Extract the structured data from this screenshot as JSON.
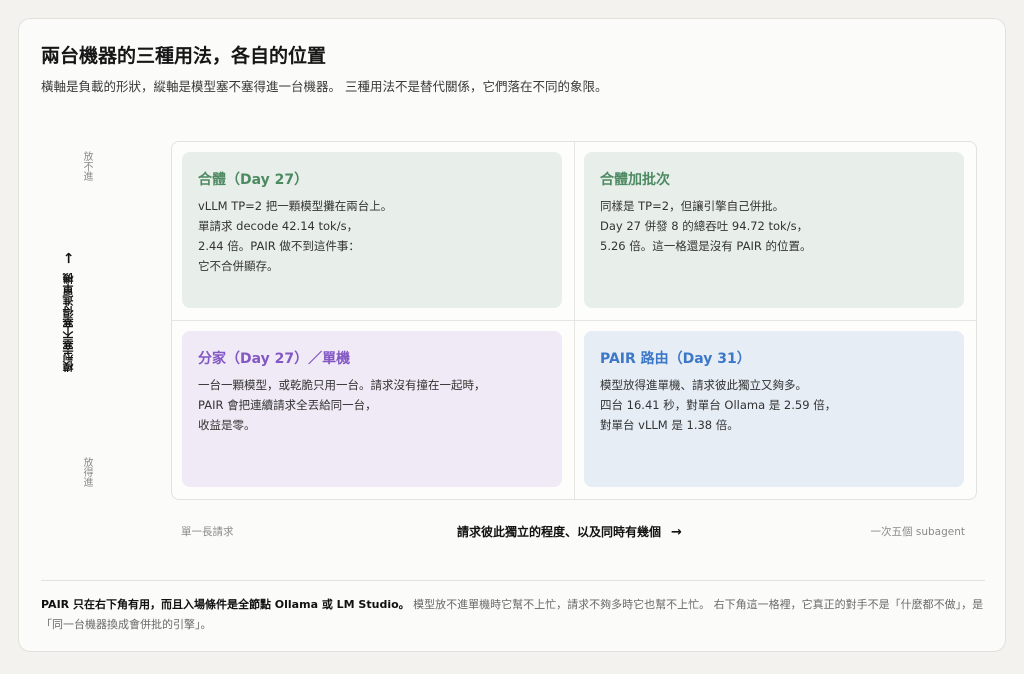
{
  "header": {
    "title": "兩台機器的三種用法，各自的位置",
    "subtitle": "橫軸是負載的形狀，縱軸是模型塞不塞得進一台機器。 三種用法不是替代關係，它們落在不同的象限。"
  },
  "y_axis": {
    "top_label": "放不進",
    "bottom_label": "放得進",
    "title": "模型塞不塞得進單機",
    "arrow": "→"
  },
  "x_axis": {
    "left_label": "單一長請求",
    "title": "請求彼此獨立的程度、以及同時有幾個",
    "arrow": "→",
    "right_label": "一次五個 subagent"
  },
  "quadrants": {
    "top_left": {
      "title": "合體（Day 27）",
      "color": "#4d8a62",
      "lines": [
        "vLLM TP=2 把一顆模型攤在兩台上。",
        "單請求 decode 42.14 tok/s，",
        "2.44 倍。PAIR 做不到這件事：",
        "它不合併顯存。"
      ]
    },
    "top_right": {
      "title": "合體加批次",
      "color": "#4d8a62",
      "lines": [
        "同樣是 TP=2，但讓引擎自己併批。",
        "Day 27 併發 8 的總吞吐 94.72 tok/s，",
        "5.26 倍。這一格還是沒有 PAIR 的位置。"
      ]
    },
    "bottom_left": {
      "title": "分家（Day 27）／單機",
      "color": "#8458c4",
      "lines": [
        "一台一顆模型，或乾脆只用一台。請求沒有撞在一起時，",
        "PAIR 會把連續請求全丟給同一台，",
        "收益是零。"
      ]
    },
    "bottom_right": {
      "title": "PAIR 路由（Day 31）",
      "color": "#3c78c7",
      "lines": [
        "模型放得進單機、請求彼此獨立又夠多。",
        "四台 16.41 秒，對單台 Ollama 是 2.59 倍，",
        "對單台 vLLM 是 1.38 倍。"
      ]
    }
  },
  "footer": {
    "strong": "PAIR 只在右下角有用，而且入場條件是全節點 Ollama 或 LM Studio。",
    "rest": " 模型放不進單機時它幫不上忙，請求不夠多時它也幫不上忙。 右下角這一格裡，它真正的對手不是「什麼都不做」，是「同一台機器換成會併批的引擎」。"
  }
}
